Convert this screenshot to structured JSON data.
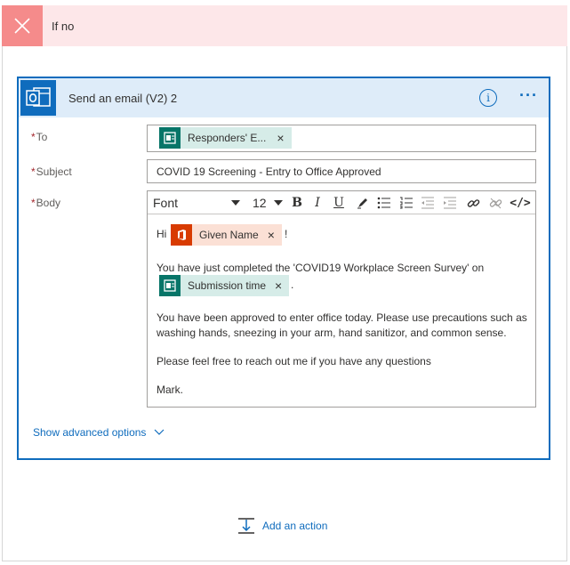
{
  "condition": {
    "title": "If no",
    "close_icon": "close-icon"
  },
  "action": {
    "title": "Send an email (V2) 2",
    "info_glyph": "i",
    "more_glyph": "···",
    "accent": "#0f6cbd"
  },
  "fields": {
    "to": {
      "label": "To",
      "required_mark": "*",
      "token": {
        "label": "Responders' E...",
        "remove": "×",
        "color": "#077568"
      }
    },
    "subject": {
      "label": "Subject",
      "required_mark": "*",
      "value": "COVID 19 Screening - Entry to Office Approved"
    },
    "body": {
      "label": "Body",
      "required_mark": "*",
      "toolbar": {
        "font": "Font",
        "size": "12",
        "bold": "B",
        "italic": "I",
        "underline": "U",
        "code": "</>"
      },
      "content": {
        "greeting": "Hi",
        "name_token": {
          "label": "Given Name",
          "remove": "×",
          "color": "#d83b01"
        },
        "greeting_end": "!",
        "line1": "You have just completed the 'COVID19 Workplace Screen Survey' on",
        "time_token": {
          "label": "Submission time",
          "remove": "×"
        },
        "line1_end": ".",
        "line2a": "You have been approved to enter office today. Please use precautions such as",
        "line2b": "washing hands, sneezing in your arm, hand sanitizor, and common sense.",
        "line3": "Please feel free to reach out me if you have any questions",
        "sign": "Mark."
      }
    }
  },
  "advanced": {
    "label": "Show advanced options"
  },
  "add_action": {
    "label": "Add an action"
  }
}
